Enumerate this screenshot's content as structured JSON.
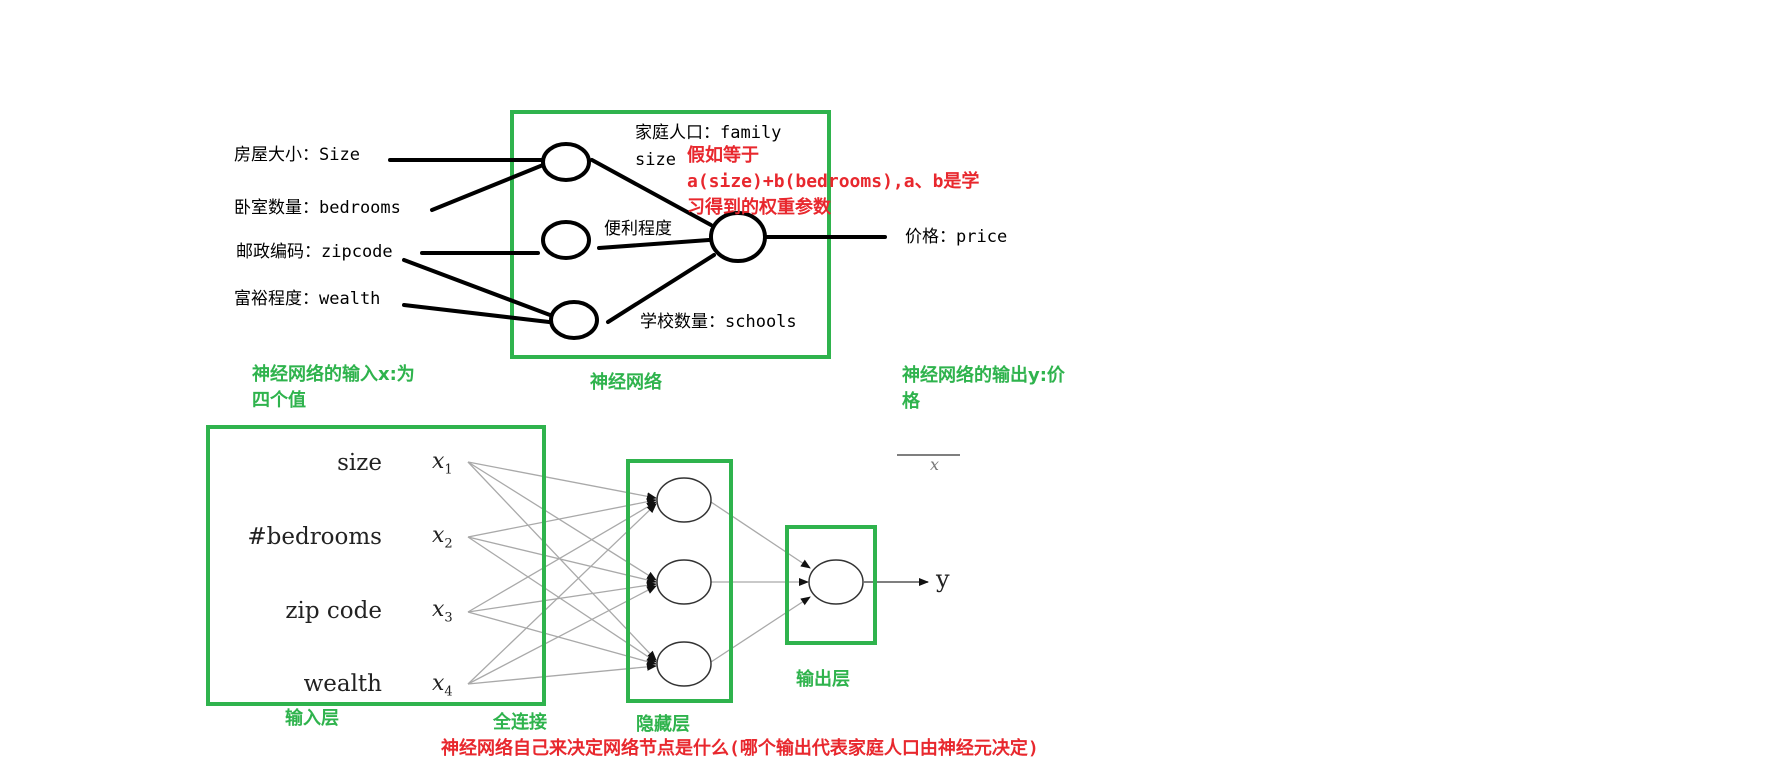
{
  "colors": {
    "green_box": "#2fb34d",
    "green_text": "#2fb34d",
    "red_text": "#e8282e",
    "black": "#000000",
    "gray_line": "#a9a9a9"
  },
  "top_diagram": {
    "inputs": {
      "size": "房屋大小：Size",
      "bedrooms": "卧室数量：bedrooms",
      "zipcode": "邮政编码：zipcode",
      "wealth": "富裕程度：wealth"
    },
    "hidden": {
      "family_line1": "家庭人口：family",
      "family_line2": "size",
      "convenience": "便利程度",
      "schools": "学校数量：schools"
    },
    "output": "价格：price",
    "annotation": {
      "line1": "假如等于",
      "line2": "a(size)+b(bedrooms),a、b是学",
      "line3": "习得到的权重参数"
    },
    "caption_input_line1": "神经网络的输入x:为",
    "caption_input_line2": "四个值",
    "caption_network": "神经网络",
    "caption_output_line1": "神经网络的输出y:价",
    "caption_output_line2": "格"
  },
  "bottom_diagram": {
    "features": [
      "size",
      "#bedrooms",
      "zip code",
      "wealth"
    ],
    "vars": [
      "1",
      "2",
      "3",
      "4"
    ],
    "var_symbol": "x",
    "stray_symbol": "x",
    "output": "y",
    "caption_input_layer": "输入层",
    "caption_full": "全连接",
    "caption_hidden": "隐藏层",
    "caption_output_layer": "输出层",
    "footnote": "神经网络自己来决定网络节点是什么(哪个输出代表家庭人口由神经元决定)"
  }
}
